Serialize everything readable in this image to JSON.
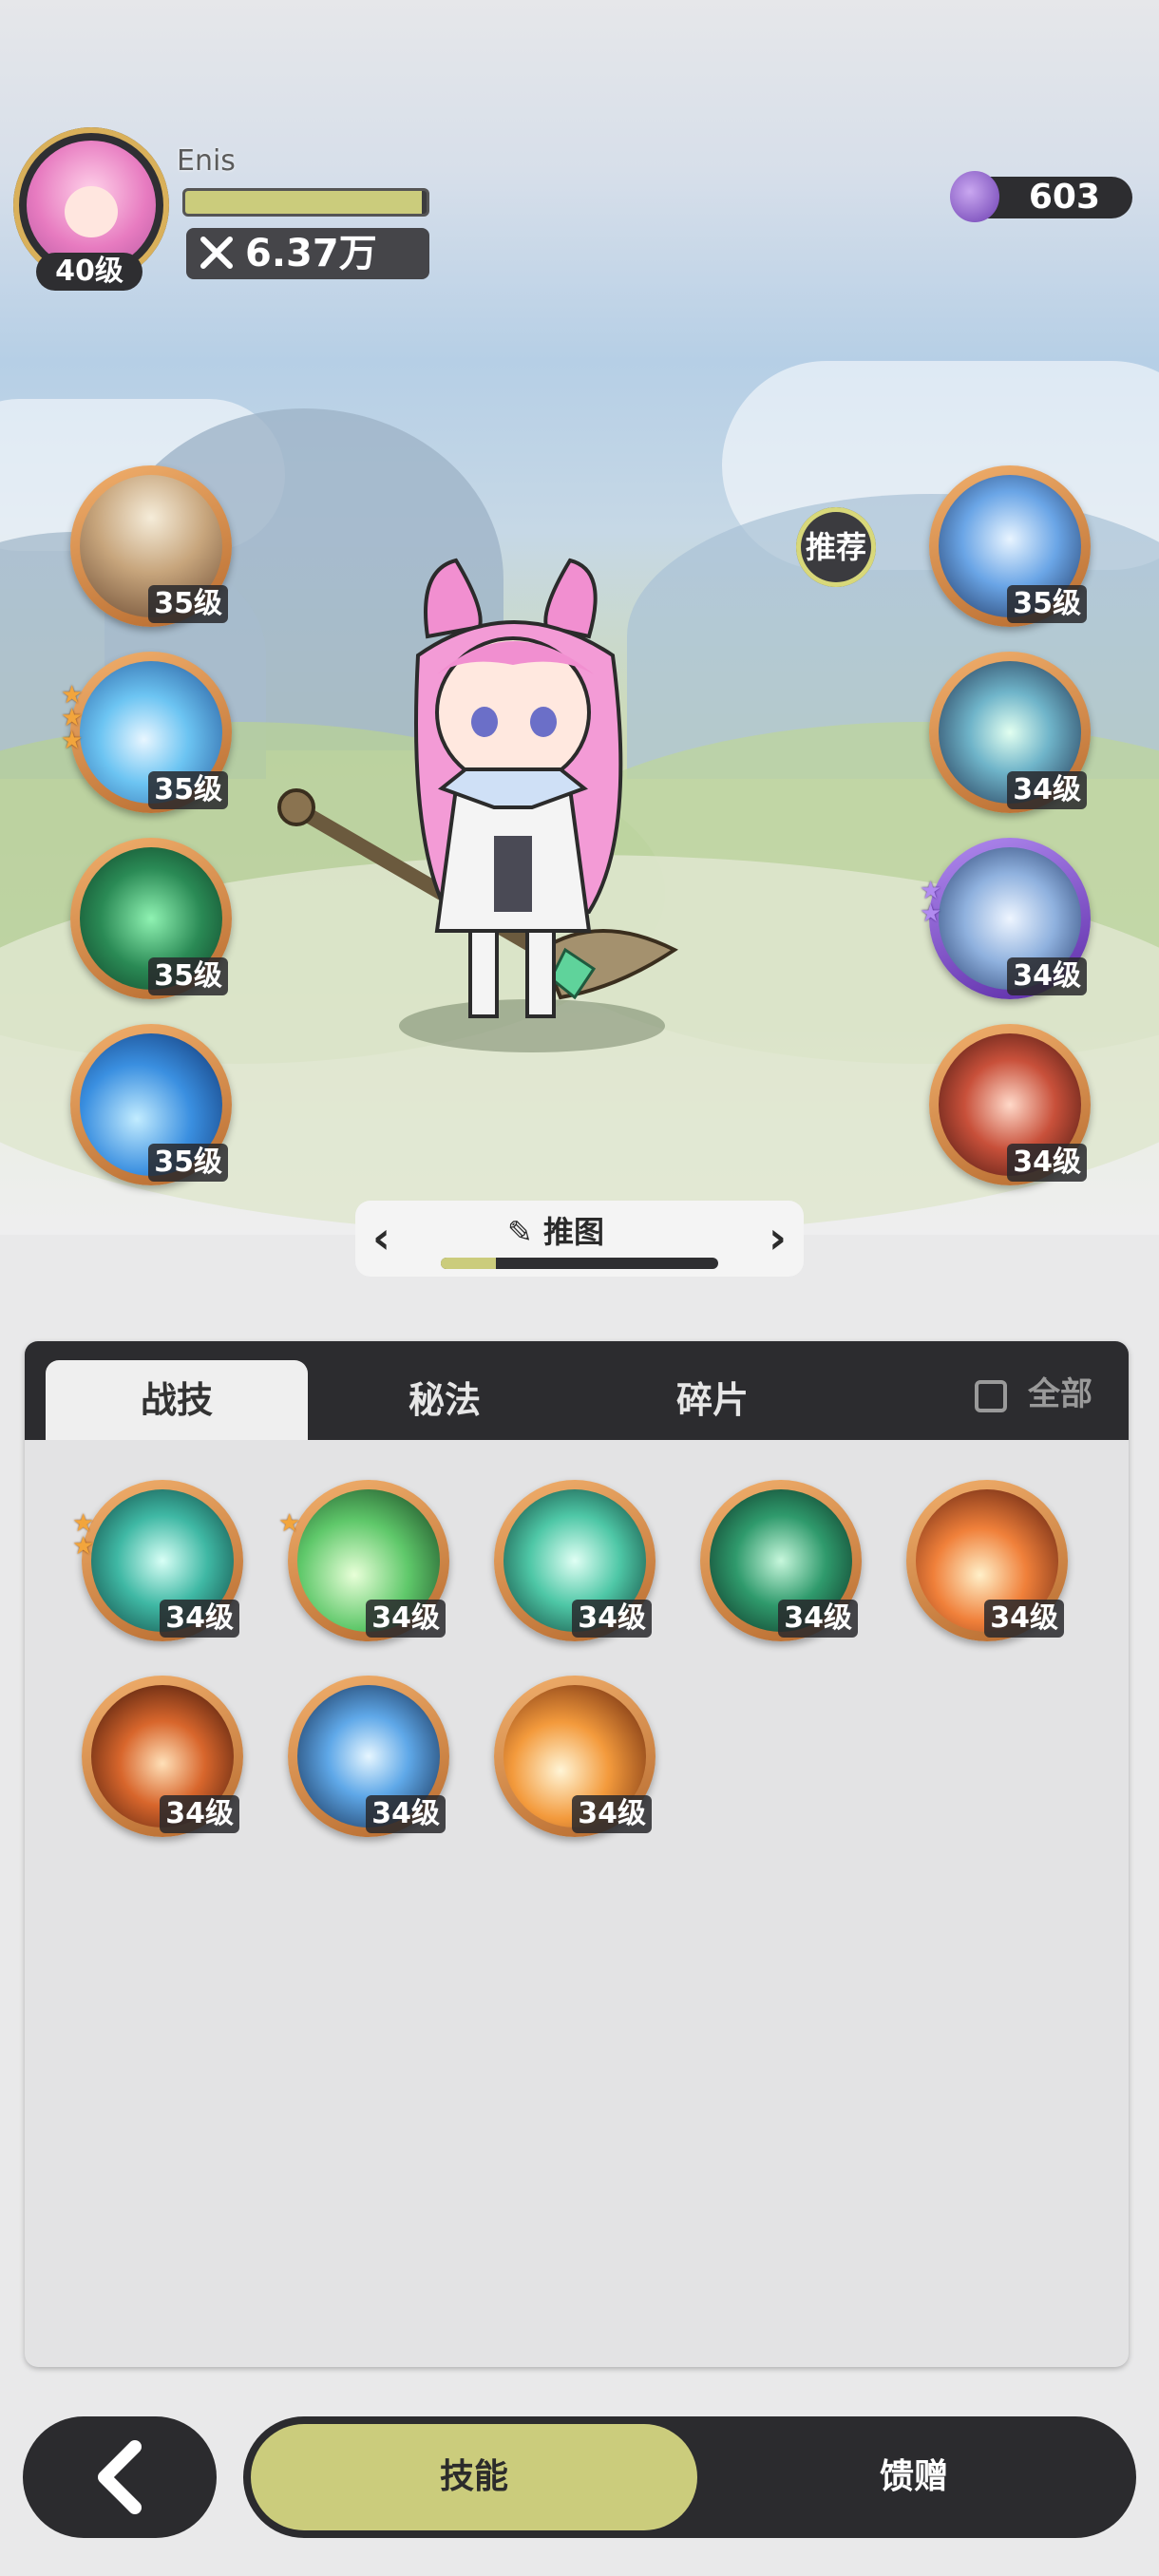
{
  "player": {
    "name": "Enis",
    "level": "40级",
    "power": "6.37万",
    "exp_fraction": 0.98
  },
  "currency": {
    "amount": "603"
  },
  "recommend_label": "推荐",
  "left_skills": [
    {
      "level": "35级",
      "stars": 0,
      "icon": "cards-skill-icon"
    },
    {
      "level": "35级",
      "stars": 3,
      "icon": "ice-burst-skill-icon"
    },
    {
      "level": "35级",
      "stars": 0,
      "icon": "heal-plus-skill-icon"
    },
    {
      "level": "35级",
      "stars": 0,
      "icon": "water-wave-skill-icon"
    }
  ],
  "right_skills": [
    {
      "level": "35级",
      "stars": 0,
      "icon": "ice-crystal-skill-icon"
    },
    {
      "level": "34级",
      "stars": 0,
      "icon": "star-sparkle-skill-icon"
    },
    {
      "level": "34级",
      "stars": 2,
      "icon": "orb-shield-skill-icon",
      "rarity": "purple"
    },
    {
      "level": "34级",
      "stars": 0,
      "icon": "fire-ring-skill-icon"
    }
  ],
  "mode_selector": {
    "label": "推图",
    "progress": 0.2
  },
  "tabs": [
    {
      "label": "战技",
      "active": true
    },
    {
      "label": "秘法",
      "active": false
    },
    {
      "label": "碎片",
      "active": false
    }
  ],
  "filter_all": "全部",
  "inventory_skills": [
    {
      "level": "34级",
      "stars": 2,
      "icon": "whirlwind-skill-icon"
    },
    {
      "level": "34级",
      "stars": 1,
      "icon": "green-slash-skill-icon"
    },
    {
      "level": "34级",
      "stars": 0,
      "icon": "wind-blade-skill-icon"
    },
    {
      "level": "34级",
      "stars": 0,
      "icon": "thorn-vine-skill-icon"
    },
    {
      "level": "34级",
      "stars": 0,
      "icon": "flame-skill-icon"
    },
    {
      "level": "34级",
      "stars": 0,
      "icon": "fire-swirl-skill-icon"
    },
    {
      "level": "34级",
      "stars": 0,
      "icon": "ice-shard-skill-icon"
    },
    {
      "level": "34级",
      "stars": 0,
      "icon": "fireball-skill-icon"
    }
  ],
  "bottom_nav": {
    "active": "技能",
    "inactive": "馈赠"
  }
}
